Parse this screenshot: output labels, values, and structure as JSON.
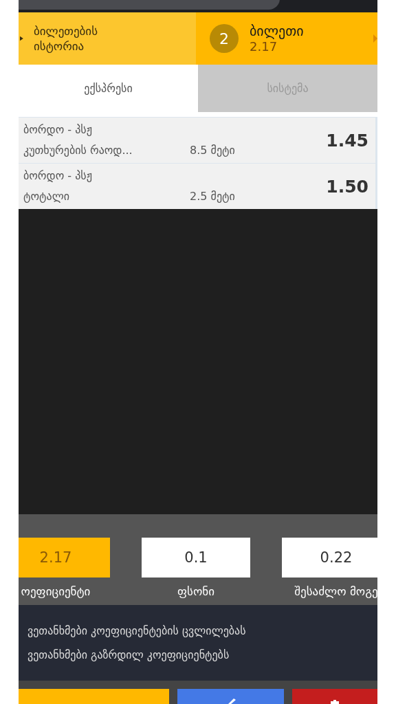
{
  "header": {
    "history_label": "ბილეთების ისტორია",
    "ticket": {
      "count": "2",
      "title": "ბილეთი",
      "odds": "2.17"
    }
  },
  "tabs": [
    {
      "label": "ექსპრესი",
      "selected": true
    },
    {
      "label": "სისტემა",
      "selected": false
    }
  ],
  "bets": [
    {
      "match": "ბორდო - პსჟ",
      "market": "კუთხურების რაოდ...",
      "outcome": "8.5 მეტი",
      "odds": "1.45"
    },
    {
      "match": "ბორდო - პსჟ",
      "market": "ტოტალი",
      "outcome": "2.5 მეტი",
      "odds": "1.50"
    }
  ],
  "summary": [
    {
      "value": "2.17",
      "label": "ოეფიციენტი",
      "kind": "readout"
    },
    {
      "value": "0.1",
      "label": "ფსონი",
      "kind": "input"
    },
    {
      "value": "0.22",
      "label": "შესაძლო მოგე",
      "kind": "readout-light"
    }
  ],
  "options": [
    "ვეთანხმები კოეფიციენტების ცვლილებას",
    "ვეთანხმები გაზრდილ კოეფიციენტებს"
  ]
}
